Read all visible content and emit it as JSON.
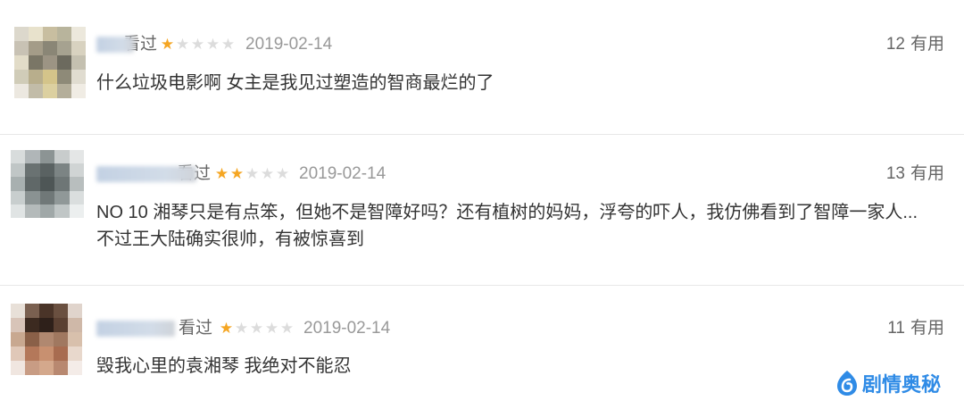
{
  "comments": [
    {
      "status": "看过",
      "rating": 1,
      "rating_max": 5,
      "date": "2019-02-14",
      "useful_count": "12",
      "useful_label": "有用",
      "content_lines": [
        "什么垃圾电影啊 女主是我见过塑造的智商最烂的了"
      ]
    },
    {
      "status": "看过",
      "rating": 2,
      "rating_max": 5,
      "date": "2019-02-14",
      "useful_count": "13",
      "useful_label": "有用",
      "content_lines": [
        "NO 10 湘琴只是有点笨，但她不是智障好吗？还有植树的妈妈，浮夸的吓人，我仿佛看到了智障一家人...",
        "不过王大陆确实很帅，有被惊喜到"
      ]
    },
    {
      "status": "看过",
      "rating": 1,
      "rating_max": 5,
      "date": "2019-02-14",
      "useful_count": "11",
      "useful_label": "有用",
      "content_lines": [
        "毁我心里的袁湘琴 我绝对不能忍"
      ]
    }
  ],
  "watermark": {
    "text": "剧情奥秘",
    "icon": "droplet-logo-icon",
    "color": "#2f8be6"
  },
  "colors": {
    "star_filled": "#f5a623",
    "star_empty": "#dcdcdc"
  }
}
